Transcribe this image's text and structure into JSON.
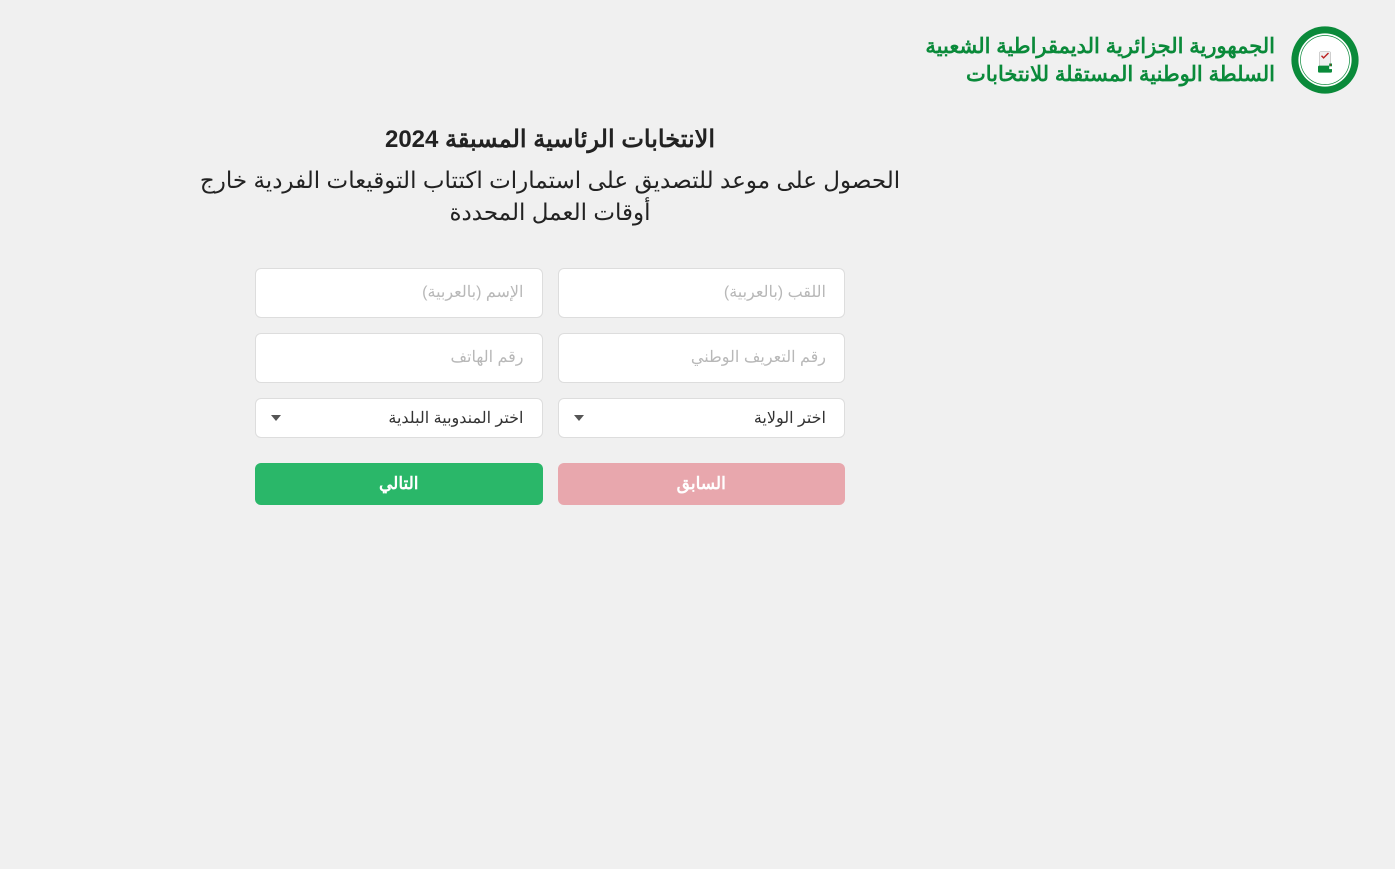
{
  "header": {
    "title1": "الجمهورية الجزائرية الديمقراطية الشعبية",
    "title2": "السلطة الوطنية المستقلة للانتخابات"
  },
  "page": {
    "title": "الانتخابات الرئاسية المسبقة 2024",
    "subtitle": "الحصول على موعد للتصديق على استمارات اكتتاب التوقيعات الفردية خارج أوقات العمل المحددة"
  },
  "form": {
    "lastname_placeholder": "اللقب (بالعربية)",
    "firstname_placeholder": "الإسم (بالعربية)",
    "national_id_placeholder": "رقم التعريف الوطني",
    "phone_placeholder": "رقم الهاتف",
    "wilaya_option": "اختر الولاية",
    "delegation_option": "اختر المندوبية البلدية"
  },
  "buttons": {
    "previous": "السابق",
    "next": "التالي"
  }
}
